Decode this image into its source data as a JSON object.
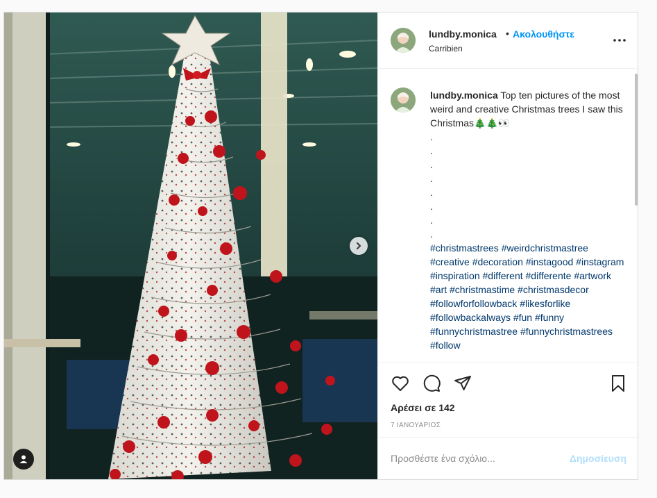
{
  "post": {
    "username": "lundby.monica",
    "separator": "•",
    "follow_label": "Ακολουθήστε",
    "location": "Carribien",
    "caption": {
      "text": "Top ten pictures of the most weird and creative Christmas trees I saw this Christmas🎄🎄👀",
      "dots": [
        ".",
        ".",
        ".",
        ".",
        ".",
        ".",
        ".",
        "."
      ],
      "hashtags": [
        "#christmastrees",
        "#weirdchristmastree",
        "#creative",
        "#decoration",
        "#instagood",
        "#instagram",
        "#inspiration",
        "#different",
        "#differente",
        "#artwork",
        "#art",
        "#christmastime",
        "#christmasdecor",
        "#followforfollowback",
        "#likesforlike",
        "#followbackalways",
        "#fun",
        "#funny",
        "#funnychristmastree",
        "#funnychristmastrees",
        "#follow"
      ]
    },
    "likes_label": "Αρέσει σε 142",
    "date": "7 ΙΑΝΟΥΑΡΙΟΣ",
    "comment_placeholder": "Προσθέστε ένα σχόλιο...",
    "publish_label": "Δημοσίευση"
  },
  "icons": {
    "more": "more-options-icon",
    "like": "heart-icon",
    "comment": "comment-icon",
    "share": "share-icon",
    "save": "bookmark-icon",
    "next": "chevron-right-icon",
    "tag": "user-tag-icon"
  },
  "colors": {
    "accent": "#0095f6",
    "hashtag": "#00376b",
    "muted": "#8e8e8e",
    "publish_disabled": "#b2dffc"
  }
}
